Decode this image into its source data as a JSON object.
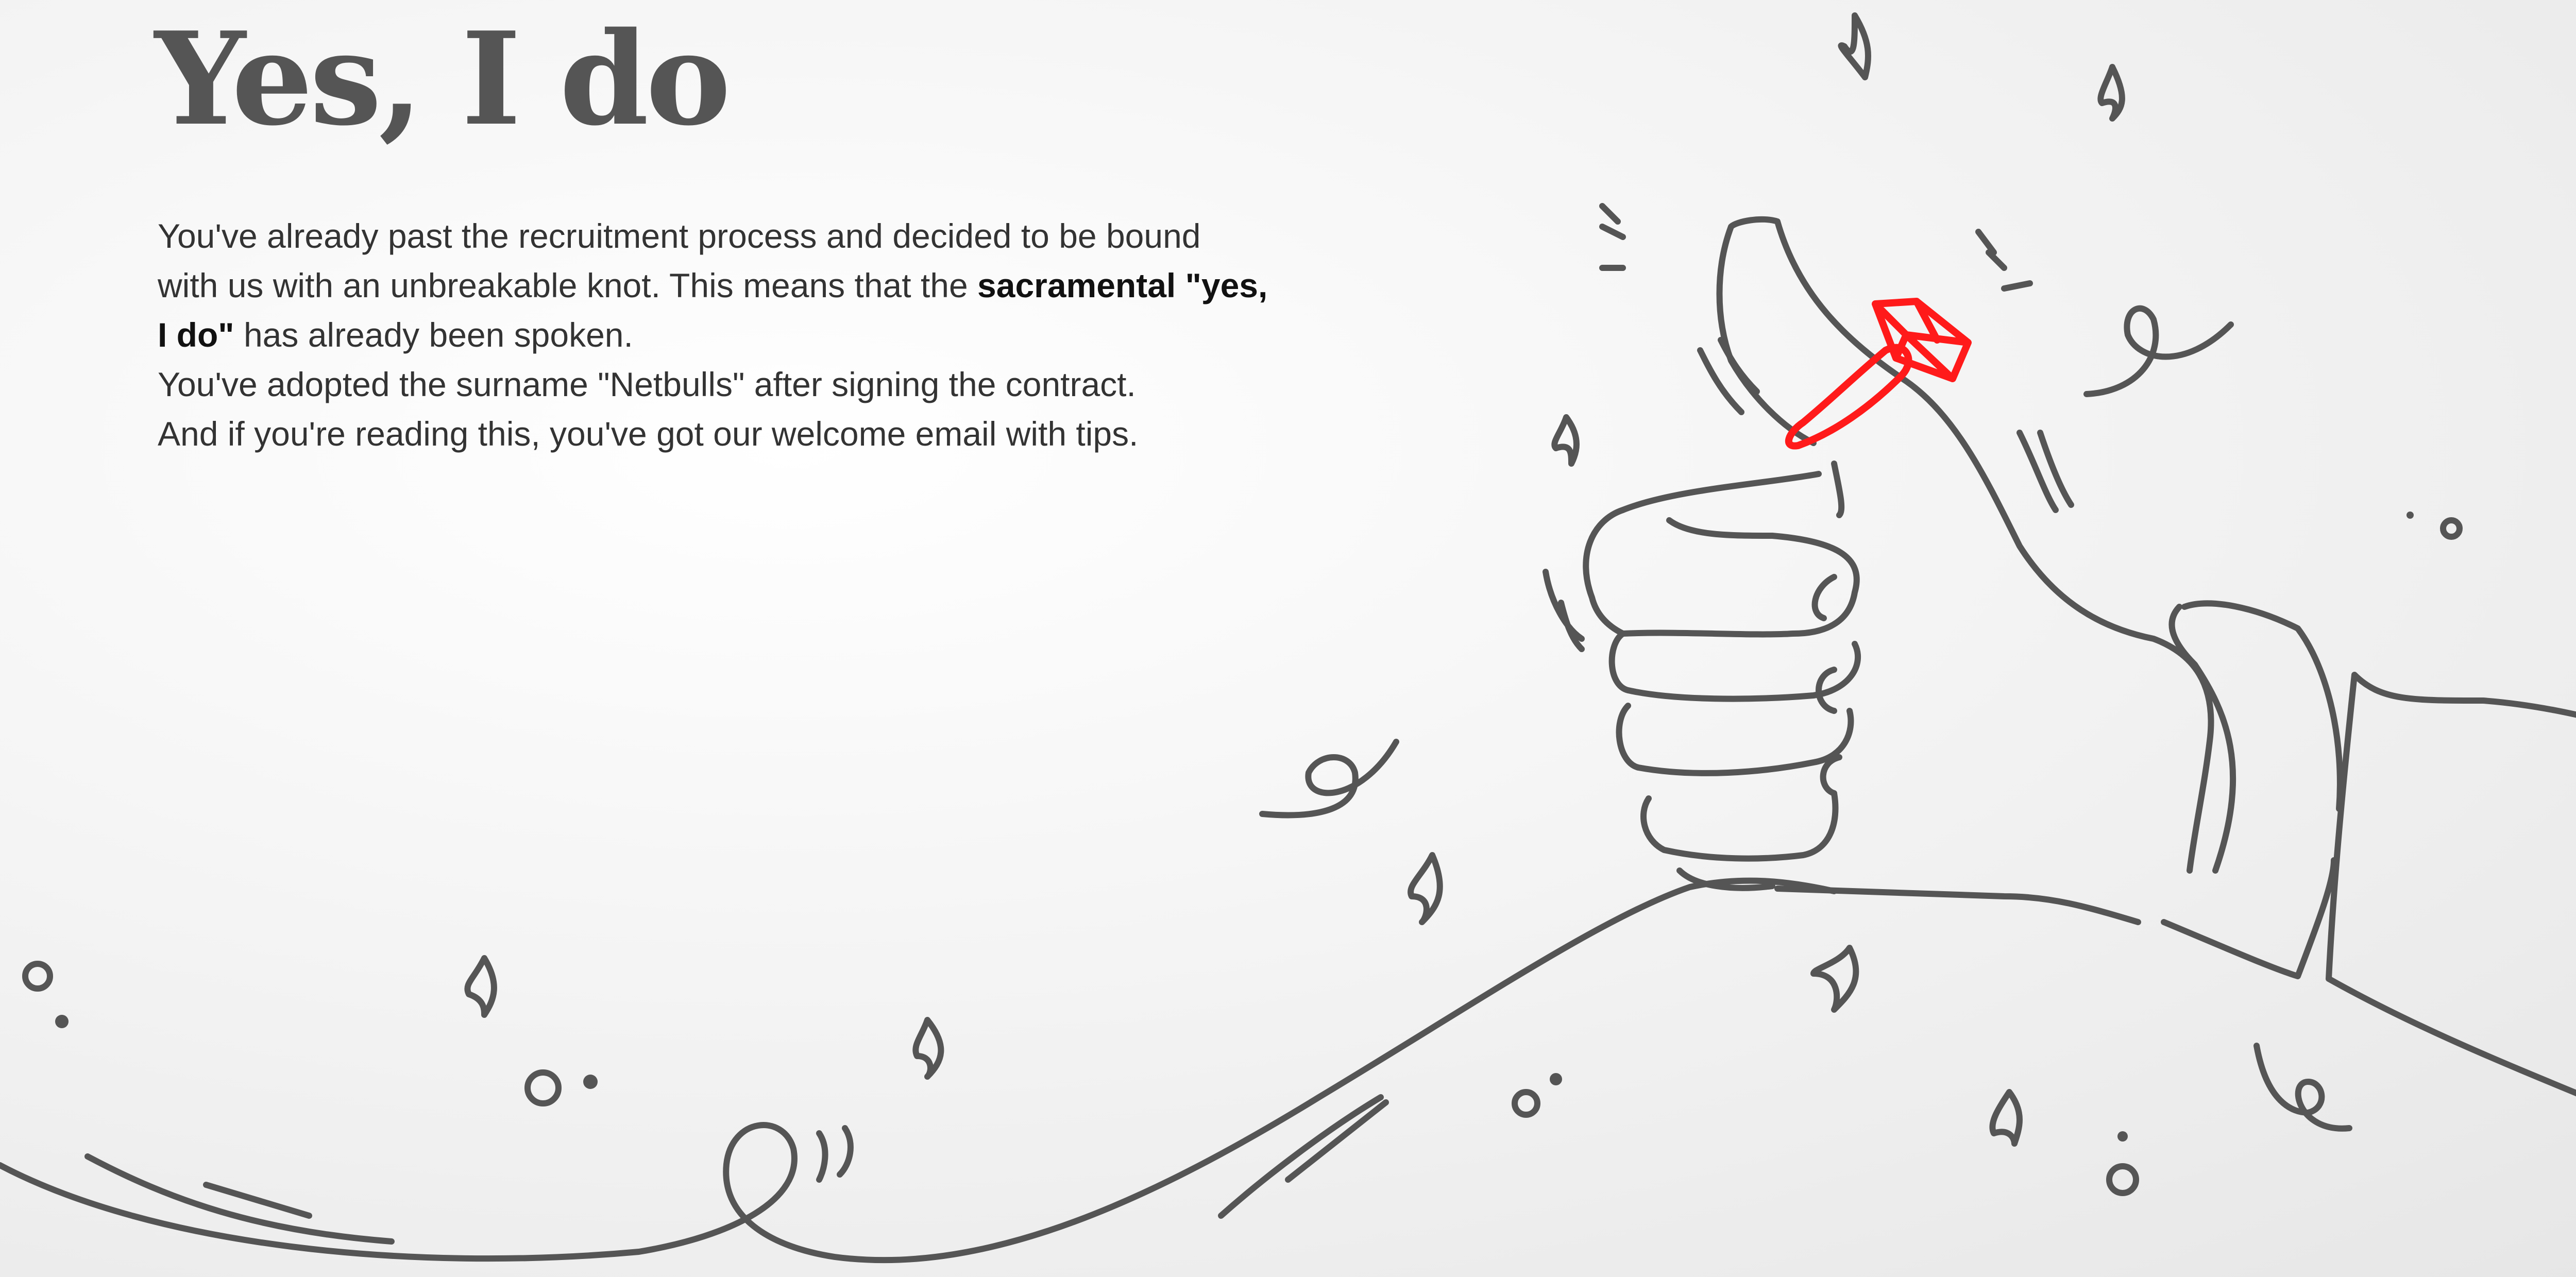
{
  "header": {
    "title": "Yes, I do"
  },
  "intro": {
    "part1": "You've already past the recruitment process and decided to be bound with us with an unbreakable knot. This means that the ",
    "emphasis": "sacramental \"yes, I do\"",
    "part2": " has already been spoken.",
    "line2": "You've adopted the surname \"Netbulls\" after signing the contract.",
    "line3": "And if you're reading this, you've got our welcome email with tips."
  },
  "illustration": {
    "subject": "thumbs-up-hand-with-diamond-ring",
    "line_color": "#555555",
    "ring_color": "#ff1a1a"
  }
}
